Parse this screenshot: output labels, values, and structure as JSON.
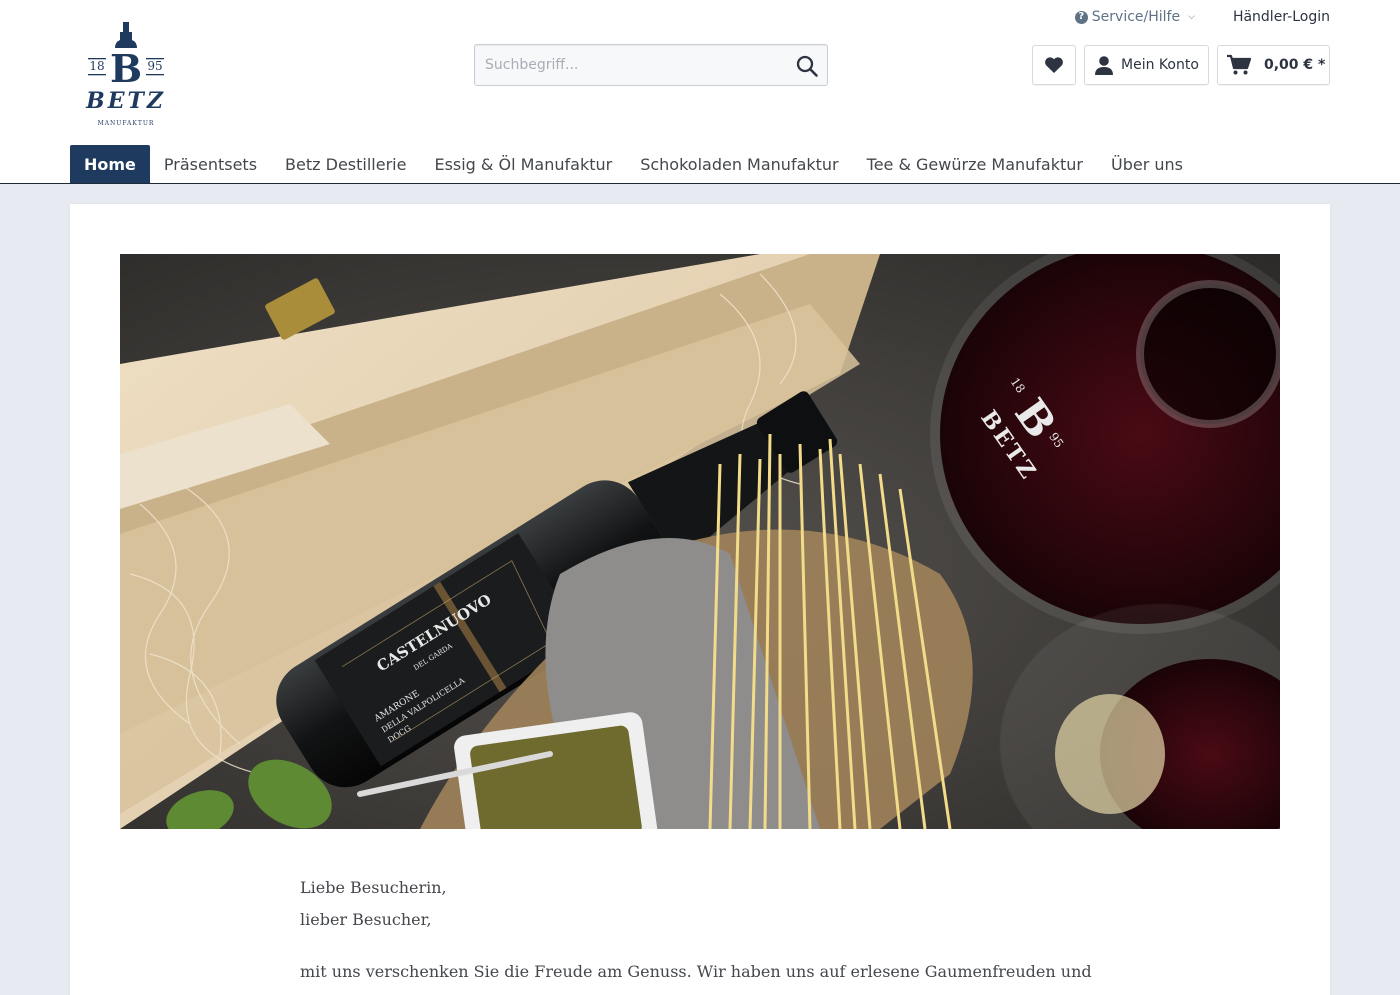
{
  "top_links": {
    "service_label": "Service/Hilfe",
    "dealer_label": "Händler-Login"
  },
  "logo": {
    "year_left": "18",
    "year_right": "95",
    "letter": "B",
    "name": "BETZ",
    "subtitle": "MANUFAKTUR"
  },
  "search": {
    "placeholder": "Suchbegriff..."
  },
  "account": {
    "label": "Mein Konto"
  },
  "cart": {
    "total": "0,00 € *"
  },
  "nav": {
    "items": [
      {
        "label": "Home",
        "active": true
      },
      {
        "label": "Präsentsets"
      },
      {
        "label": "Betz Destillerie"
      },
      {
        "label": "Essig & Öl Manufaktur"
      },
      {
        "label": "Schokoladen Manufaktur"
      },
      {
        "label": "Tee & Gewürze Manufaktur"
      },
      {
        "label": "Über uns"
      }
    ]
  },
  "hero": {
    "label_brand": "CASTELNUOVO",
    "label_sub": "DEL GARDA",
    "label_wine_1": "AMARONE",
    "label_wine_2": "DELLA VALPOLICELLA",
    "label_wine_3": "DOCG",
    "decanter_year_left": "18",
    "decanter_year_right": "95",
    "decanter_letter": "B",
    "decanter_name": "BETZ"
  },
  "intro": {
    "greeting_1": "Liebe Besucherin,",
    "greeting_2": "lieber Besucher,",
    "paragraph": "mit uns verschenken Sie die Freude am Genuss. Wir haben uns auf erlesene Gaumenfreuden und Geschenke"
  },
  "colors": {
    "primary": "#1f3a5f",
    "accent_blue": "#5f7285",
    "background": "#e8eaf1"
  }
}
